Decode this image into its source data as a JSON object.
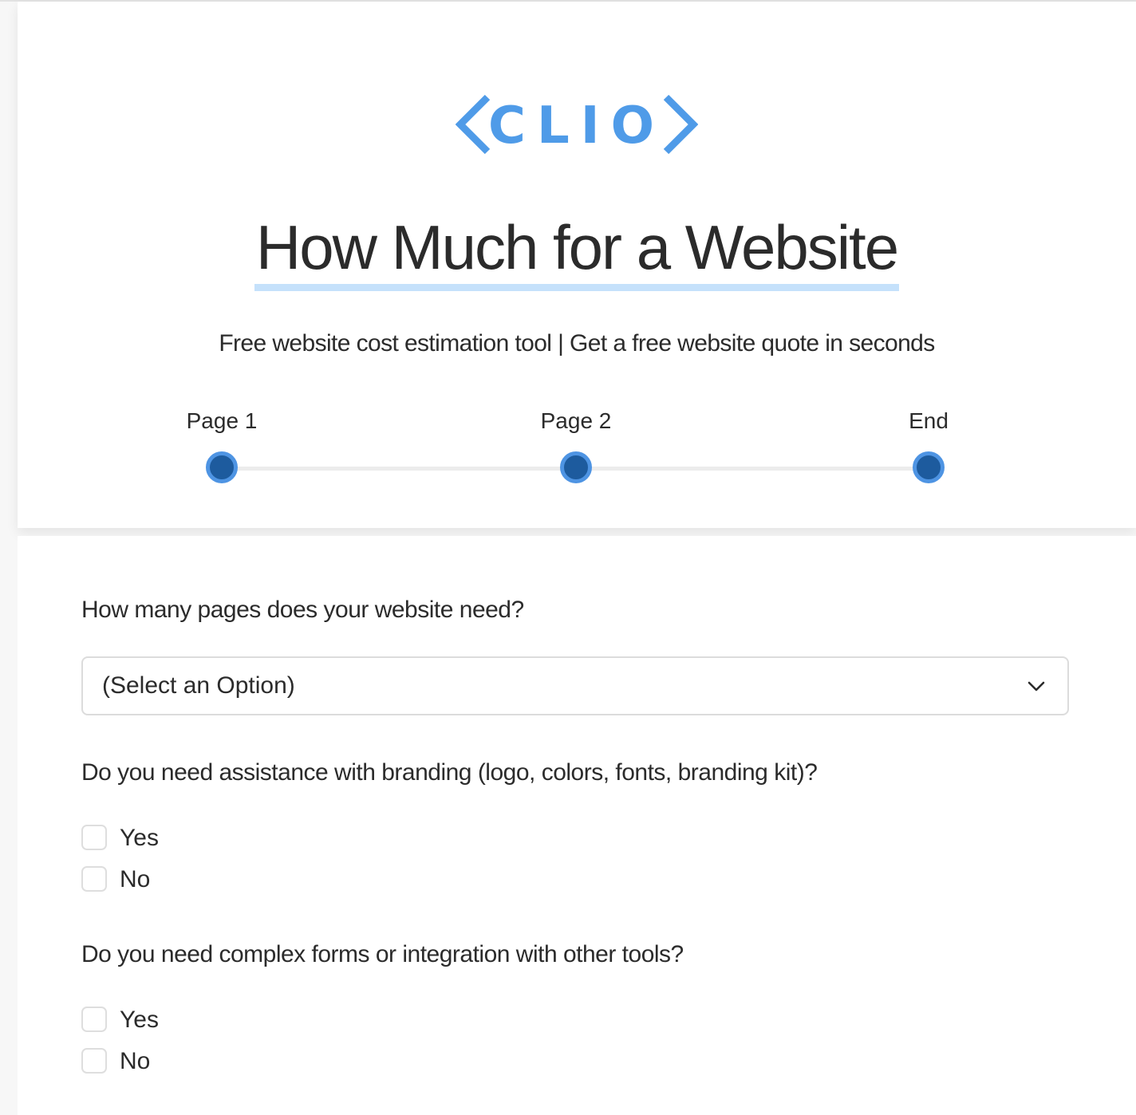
{
  "brand": {
    "logo_text": "<CLIO>",
    "logo_color": "#4f9be8"
  },
  "header": {
    "title": "How Much for a Website",
    "subtitle": "Free website cost estimation tool | Get a free website quote in seconds",
    "underline_color": "#c5e1fb"
  },
  "progress": {
    "steps": [
      {
        "label": "Page 1"
      },
      {
        "label": "Page 2"
      },
      {
        "label": "End"
      }
    ],
    "dot_fill": "#1d5b9e",
    "dot_ring": "#4e94e3"
  },
  "form": {
    "q1": {
      "text": "How many pages does your website need?",
      "selected": "(Select an Option)",
      "icon": "chevron-down-icon"
    },
    "q2": {
      "text": "Do you need assistance with branding (logo, colors, fonts, branding kit)?",
      "options": [
        {
          "label": "Yes",
          "checked": false
        },
        {
          "label": "No",
          "checked": false
        }
      ]
    },
    "q3": {
      "text": "Do you need complex forms or integration with other tools?",
      "options": [
        {
          "label": "Yes",
          "checked": false
        },
        {
          "label": "No",
          "checked": false
        }
      ]
    }
  }
}
